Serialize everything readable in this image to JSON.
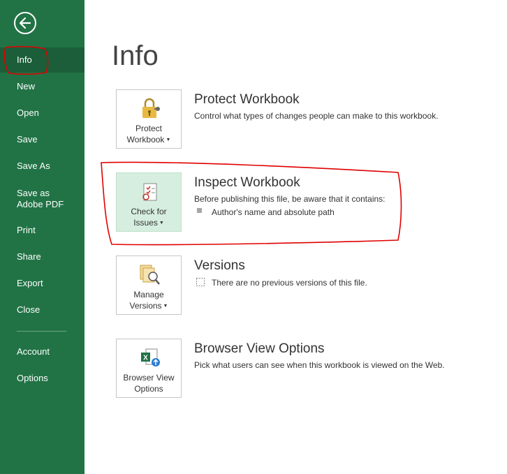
{
  "sidebar": {
    "back_label": "Back",
    "items": [
      {
        "label": "Info"
      },
      {
        "label": "New"
      },
      {
        "label": "Open"
      },
      {
        "label": "Save"
      },
      {
        "label": "Save As"
      },
      {
        "label": "Save as Adobe PDF"
      },
      {
        "label": "Print"
      },
      {
        "label": "Share"
      },
      {
        "label": "Export"
      },
      {
        "label": "Close"
      },
      {
        "label": "Account"
      },
      {
        "label": "Options"
      }
    ]
  },
  "page_title": "Info",
  "sections": {
    "protect": {
      "button_line1": "Protect",
      "button_line2": "Workbook",
      "title": "Protect Workbook",
      "description": "Control what types of changes people can make to this workbook."
    },
    "inspect": {
      "button_line1": "Check for",
      "button_line2": "Issues",
      "title": "Inspect Workbook",
      "description": "Before publishing this file, be aware that it contains:",
      "item": "Author's name and absolute path"
    },
    "versions": {
      "button_line1": "Manage",
      "button_line2": "Versions",
      "title": "Versions",
      "item": "There are no previous versions of this file."
    },
    "browser": {
      "button_line1": "Browser View",
      "button_line2": "Options",
      "title": "Browser View Options",
      "description": "Pick what users can see when this workbook is viewed on the Web."
    }
  },
  "colors": {
    "sidebar": "#217346",
    "highlight": "#d6eedf",
    "annotation": "#e00000"
  }
}
